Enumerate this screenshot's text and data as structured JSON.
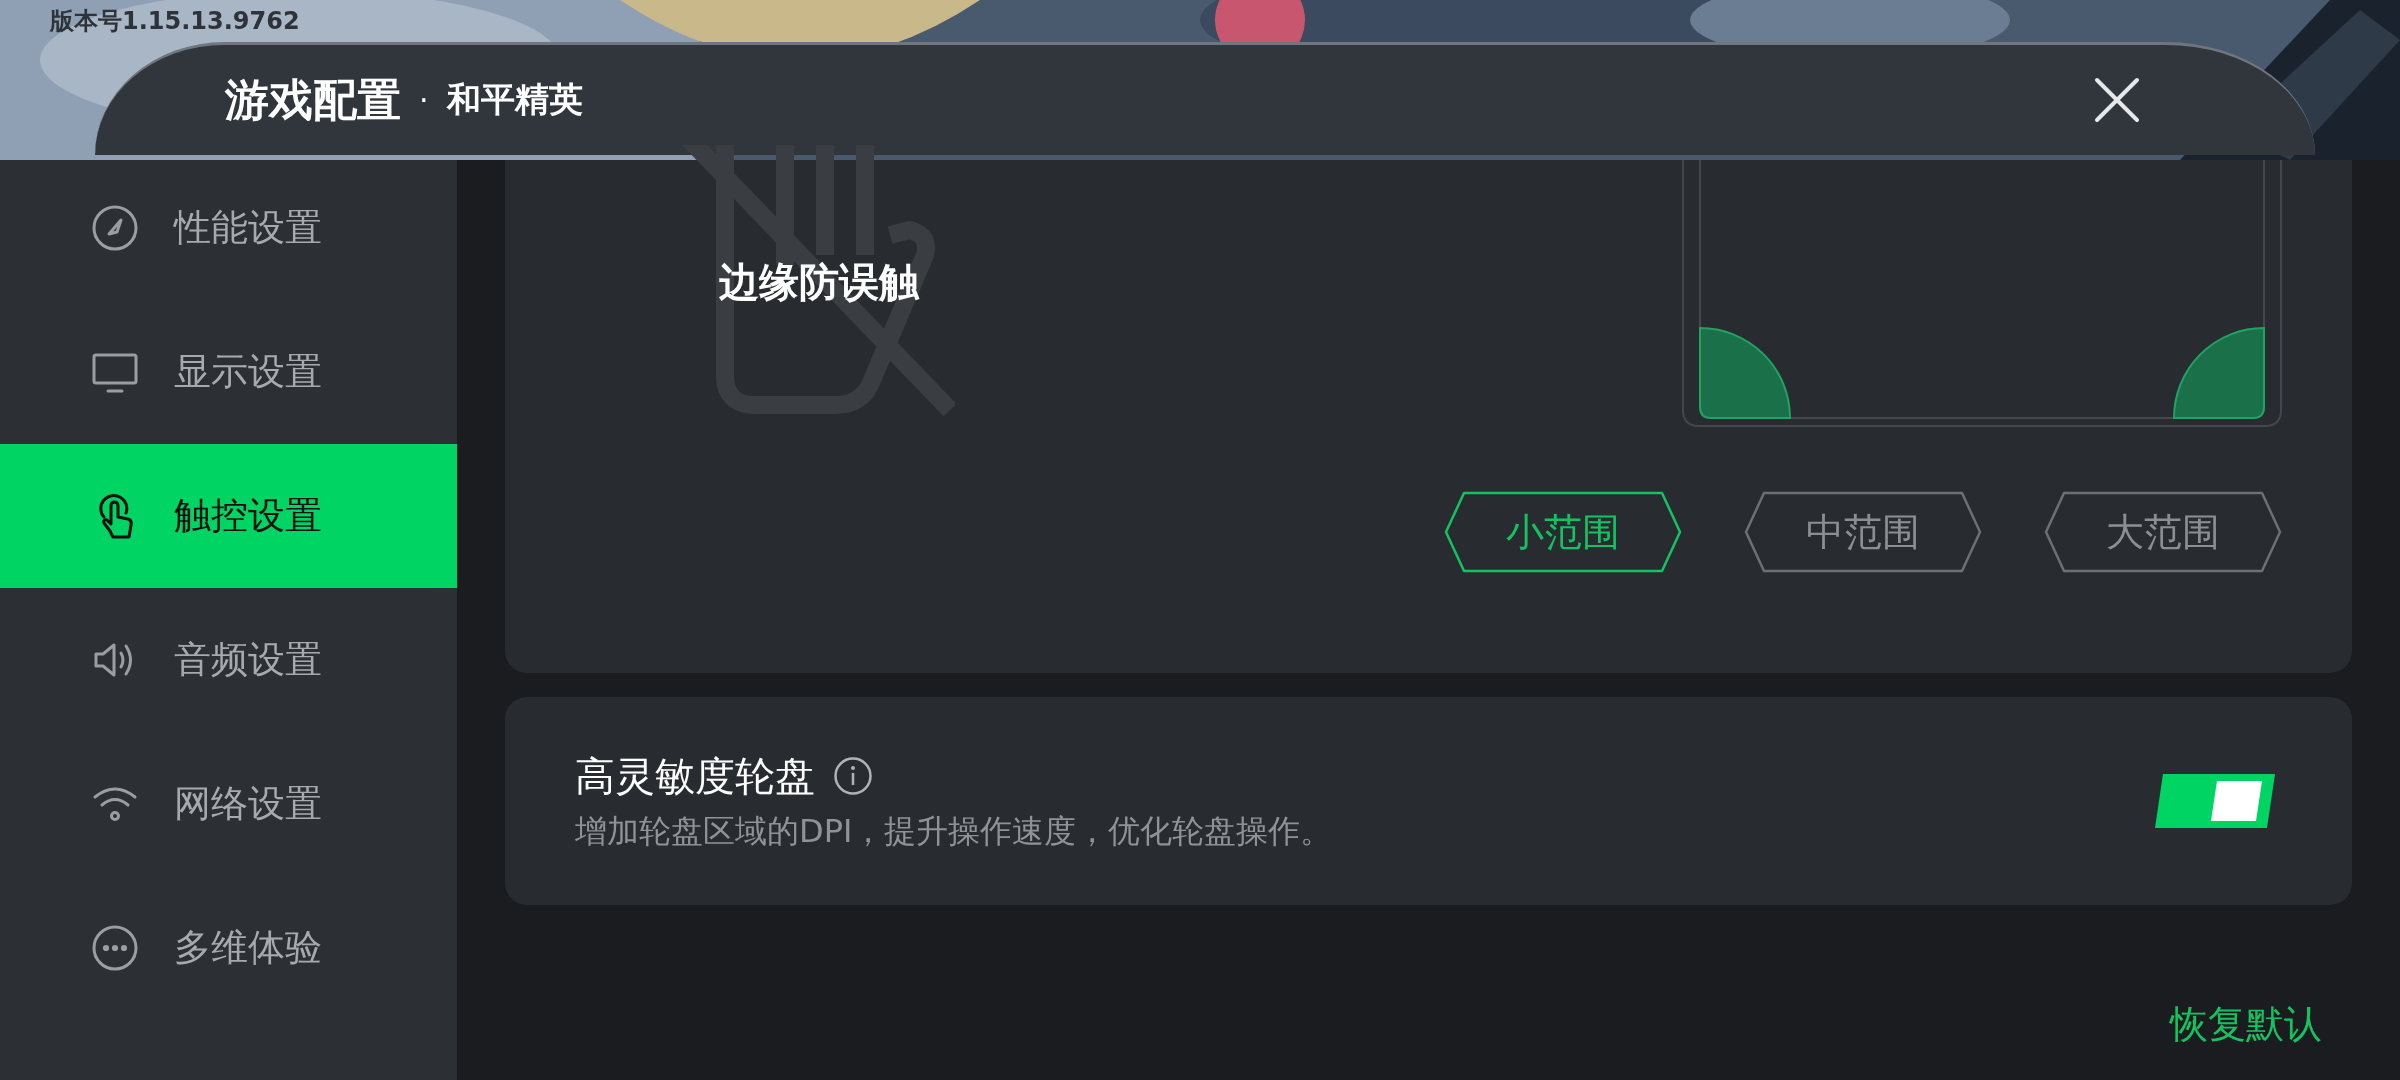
{
  "version_label": "版本号1.15.13.9762",
  "header": {
    "title": "游戏配置",
    "separator": "·",
    "game": "和平精英"
  },
  "sidebar": {
    "items": [
      {
        "label": "性能设置",
        "selected": false
      },
      {
        "label": "显示设置",
        "selected": false
      },
      {
        "label": "触控设置",
        "selected": true
      },
      {
        "label": "音频设置",
        "selected": false
      },
      {
        "label": "网络设置",
        "selected": false
      },
      {
        "label": "多维体验",
        "selected": false
      }
    ]
  },
  "edge_touch": {
    "title": "边缘防误触",
    "ranges": [
      {
        "label": "小范围",
        "selected": true
      },
      {
        "label": "中范围",
        "selected": false
      },
      {
        "label": "大范围",
        "selected": false
      }
    ]
  },
  "high_sensitivity": {
    "title": "高灵敏度轮盘",
    "description": "增加轮盘区域的DPI，提升操作速度，优化轮盘操作。",
    "on": true
  },
  "restore_default": "恢复默认"
}
